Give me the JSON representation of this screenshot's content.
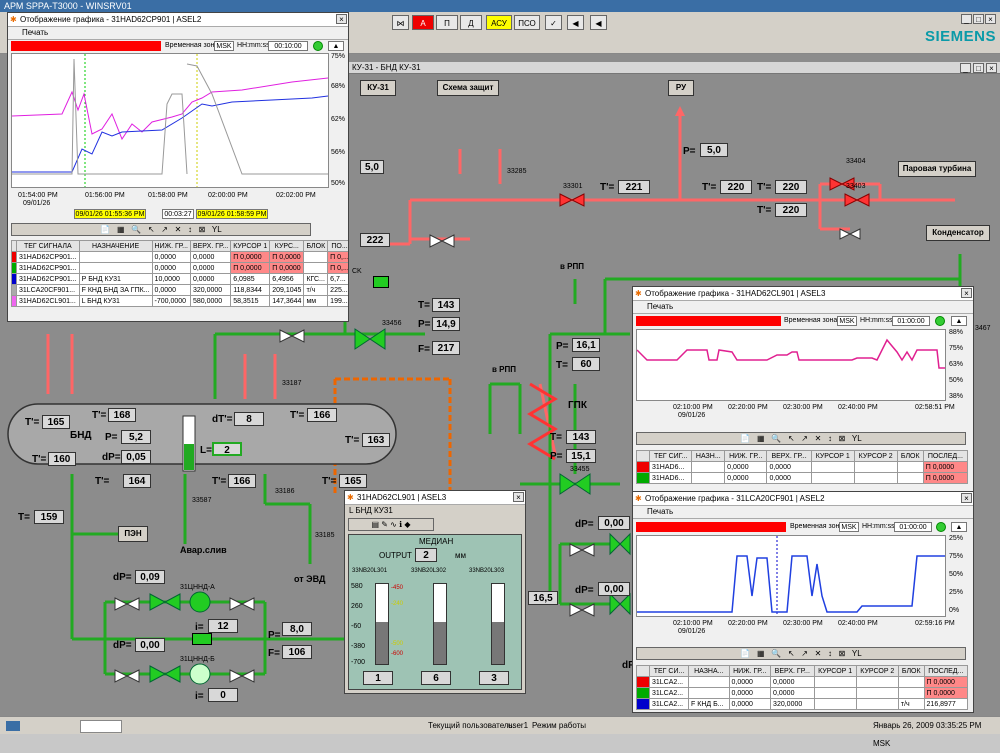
{
  "app": {
    "title": "АРМ SPPA-T3000 - WINSRV01",
    "brand": "SIEMENS"
  },
  "toolbar": {
    "buttons": [
      "А",
      "П",
      "Д",
      "АСУ",
      "ПСО"
    ]
  },
  "main_window": {
    "title": "КУ-31 - БНД КУ-31",
    "buttons": [
      "КУ-31",
      "Схема защит",
      "РУ",
      "Паровая турбина",
      "Конденсатор",
      "ПЭН"
    ]
  },
  "diagram": {
    "labels": {
      "bnd": "БНД",
      "gpk": "ГПК",
      "v_rpp_1": "в РПП",
      "v_rpp_2": "в РПП",
      "avar_sliv": "Авар.слив",
      "ot_evd": "от ЭВД",
      "pump_a": "31ЦННД-А",
      "pump_b": "31ЦННД-Б",
      "dF": "dF",
      "ck": "CK"
    },
    "tags": {
      "t33285": "33285",
      "t33301": "33301",
      "t33404": "33404",
      "t33403": "33403",
      "t33456": "33456",
      "t33187": "33187",
      "t33587": "33587",
      "t33186": "33186",
      "t33185": "33185",
      "t33455": "33455",
      "t33467": "3467"
    },
    "values": {
      "p_top": {
        "label": "P=",
        "value": "5,0"
      },
      "t_221": {
        "label": "T'=",
        "value": "221"
      },
      "t_220a": {
        "label": "T'=",
        "value": "220"
      },
      "t_220b": {
        "label": "T'=",
        "value": "220"
      },
      "t_220c": {
        "label": "T'=",
        "value": "220"
      },
      "p_ru": {
        "label": "P=",
        "value": "5,0"
      },
      "v_222": {
        "value": "222"
      },
      "t_143a": {
        "label": "T=",
        "value": "143"
      },
      "p_149": {
        "label": "P=",
        "value": "14,9"
      },
      "f_217": {
        "label": "F=",
        "value": "217"
      },
      "p_161": {
        "label": "P=",
        "value": "16,1"
      },
      "t_60": {
        "label": "T=",
        "value": "60"
      },
      "t_143b": {
        "label": "T=",
        "value": "143"
      },
      "p_151": {
        "label": "P=",
        "value": "15,1"
      },
      "t_165a": {
        "label": "T'=",
        "value": "165"
      },
      "t_168": {
        "label": "T'=",
        "value": "168"
      },
      "dt_8": {
        "label": "dT'=",
        "value": "8"
      },
      "t_166a": {
        "label": "T'=",
        "value": "166"
      },
      "t_163": {
        "label": "T'=",
        "value": "163"
      },
      "p_52": {
        "label": "P=",
        "value": "5,2"
      },
      "l_2": {
        "label": "L=",
        "value": "2"
      },
      "t_160": {
        "label": "T'=",
        "value": "160"
      },
      "dp_005": {
        "label": "dP=",
        "value": "0,05"
      },
      "t_164": {
        "label": "T'=",
        "value": "164"
      },
      "t_166b": {
        "label": "T'=",
        "value": "166"
      },
      "t_165b": {
        "label": "T'=",
        "value": "165"
      },
      "t_159": {
        "label": "T=",
        "value": "159"
      },
      "dp_009": {
        "label": "dP=",
        "value": "0,09"
      },
      "i_12": {
        "label": "i=",
        "value": "12"
      },
      "dp_000a": {
        "label": "dP=",
        "value": "0,00"
      },
      "i_0": {
        "label": "i=",
        "value": "0"
      },
      "p_80": {
        "label": "P=",
        "value": "8,0"
      },
      "f_106": {
        "label": "F=",
        "value": "106"
      },
      "v_165": {
        "value": "16,5"
      },
      "dp_000b": {
        "label": "dP=",
        "value": "0,00"
      },
      "dp_000c": {
        "label": "dP=",
        "value": "0,00"
      }
    }
  },
  "trend1": {
    "title": "Отображение графика - 31HAD62CP901 | ASEL2",
    "print": "Печать",
    "timezone_label": "Временная зона:",
    "timezone": "MSK",
    "format": "HH:mm:ss",
    "time": "00:10:00",
    "y_ticks": [
      "75%",
      "68%",
      "62%",
      "56%",
      "50%"
    ],
    "x_ticks": [
      "01:54:00 PM",
      "01:56:00 PM",
      "01:58:00 PM",
      "02:00:00 PM",
      "02:02:00 PM"
    ],
    "date": "09/01/26",
    "cursor1": "09/01/26 01:55:36 PM",
    "interval": "00:03:27",
    "cursor2": "09/01/26 01:58:59 PM",
    "table_headers": [
      "ТЕГ СИГНАЛА",
      "НАЗНАЧЕНИЕ",
      "НИЖ. ГР...",
      "ВЕРХ. ГР...",
      "КУРСОР 1",
      "КУРС...",
      "БЛОК",
      "ПО..."
    ],
    "rows": [
      {
        "color": "#e00",
        "tag": "31HAD62CP901...",
        "name": "",
        "low": "0,0000",
        "high": "0,0000",
        "c1": "П 0,0000",
        "c2": "П 0,0000",
        "block": "",
        "last": "П 0,..."
      },
      {
        "color": "#0a0",
        "tag": "31HAD62CP901...",
        "name": "",
        "low": "0,0000",
        "high": "0,0000",
        "c1": "П 0,0000",
        "c2": "П 0,0000",
        "block": "",
        "last": "П 0,..."
      },
      {
        "color": "#00c",
        "tag": "31HAD62CP901...",
        "name": "Р БНД КУ31",
        "low": "10,0000",
        "high": "0,0000",
        "c1": "6,0985",
        "c2": "6,4956",
        "block": "КГС...",
        "last": "6,7..."
      },
      {
        "color": "#aaa",
        "tag": "31LCA20CF901...",
        "name": "F КНД БНД ЗА ГПК...",
        "low": "0,0000",
        "high": "320,0000",
        "c1": "118,8344",
        "c2": "209,1045",
        "block": "т/ч",
        "last": "225..."
      },
      {
        "color": "#e6e",
        "tag": "31HAD62CL901...",
        "name": "L БНД КУ31",
        "low": "-700,0000",
        "high": "580,0000",
        "c1": "58,3515",
        "c2": "147,3644",
        "block": "мм",
        "last": "199..."
      }
    ]
  },
  "trend2": {
    "title": "Отображение графика - 31HAD62CL901 | ASEL3",
    "print": "Печать",
    "timezone_label": "Временная зона:",
    "timezone": "MSK",
    "format": "HH:mm:ss",
    "time": "01:00:00",
    "y_ticks": [
      "88%",
      "75%",
      "63%",
      "50%",
      "38%"
    ],
    "x_ticks": [
      "02:10:00 PM",
      "02:20:00 PM",
      "02:30:00 PM",
      "02:40:00 PM",
      "02:58:51 PM"
    ],
    "date": "09/01/26",
    "table_headers": [
      "ТЕГ СИГ...",
      "НАЗН...",
      "НИЖ. ГР...",
      "ВЕРХ. ГР...",
      "КУРСОР 1",
      "КУРСОР 2",
      "БЛОК",
      "ПОСЛЕД..."
    ],
    "rows": [
      {
        "color": "#e00",
        "tag": "31HAD6...",
        "low": "0,0000",
        "high": "0,0000",
        "last": "П 0,0000"
      },
      {
        "color": "#0a0",
        "tag": "31HAD6...",
        "low": "0,0000",
        "high": "0,0000",
        "last": "П 0,0000"
      }
    ]
  },
  "trend3": {
    "title": "Отображение графика - 31LCA20CF901 | ASEL2",
    "print": "Печать",
    "timezone_label": "Временная зона:",
    "timezone": "MSK",
    "format": "HH:mm:ss",
    "time": "01:00:00",
    "y_ticks": [
      "25%",
      "75%",
      "50%",
      "25%",
      "0%"
    ],
    "x_ticks": [
      "02:10:00 PM",
      "02:20:00 PM",
      "02:30:00 PM",
      "02:40:00 PM",
      "02:59:16 PM"
    ],
    "date": "09/01/26",
    "table_headers": [
      "ТЕГ СИ...",
      "НАЗНА...",
      "НИЖ. ГР...",
      "ВЕРХ. ГР...",
      "КУРСОР 1",
      "КУРСОР 2",
      "БЛОК",
      "ПОСЛЕД..."
    ],
    "rows": [
      {
        "color": "#e00",
        "tag": "31LCA2...",
        "name": "",
        "low": "0,0000",
        "high": "0,0000",
        "block": "",
        "last": "П 0,0000"
      },
      {
        "color": "#0a0",
        "tag": "31LCA2...",
        "name": "",
        "low": "0,0000",
        "high": "0,0000",
        "block": "",
        "last": "П 0,0000"
      },
      {
        "color": "#00c",
        "tag": "31LCA2...",
        "name": "F КНД Б...",
        "low": "0,0000",
        "high": "320,0000",
        "block": "т/ч",
        "last": "216,8977"
      }
    ]
  },
  "level_panel": {
    "title": "31HAD62CL901 | ASEL3",
    "subtitle": "L БНД КУ31",
    "median_label": "МЕДИАН",
    "output_label": "OUTPUT",
    "output_value": "2",
    "unit": "мм",
    "gauges": [
      {
        "tag": "33NB20L301",
        "value": "1"
      },
      {
        "tag": "33NB20L302",
        "value": "6"
      },
      {
        "tag": "33NB20L303",
        "value": "3"
      }
    ],
    "scale": [
      "580",
      "260",
      "-60",
      "-380",
      "-700"
    ],
    "marks": [
      "-450",
      "-240",
      "-380",
      "-500",
      "-600"
    ]
  },
  "status": {
    "user_label": "Текущий пользователь:",
    "user": "user1",
    "mode": "Режим работы",
    "datetime": "Январь 26, 2009 03:35:25 PM MSK"
  }
}
